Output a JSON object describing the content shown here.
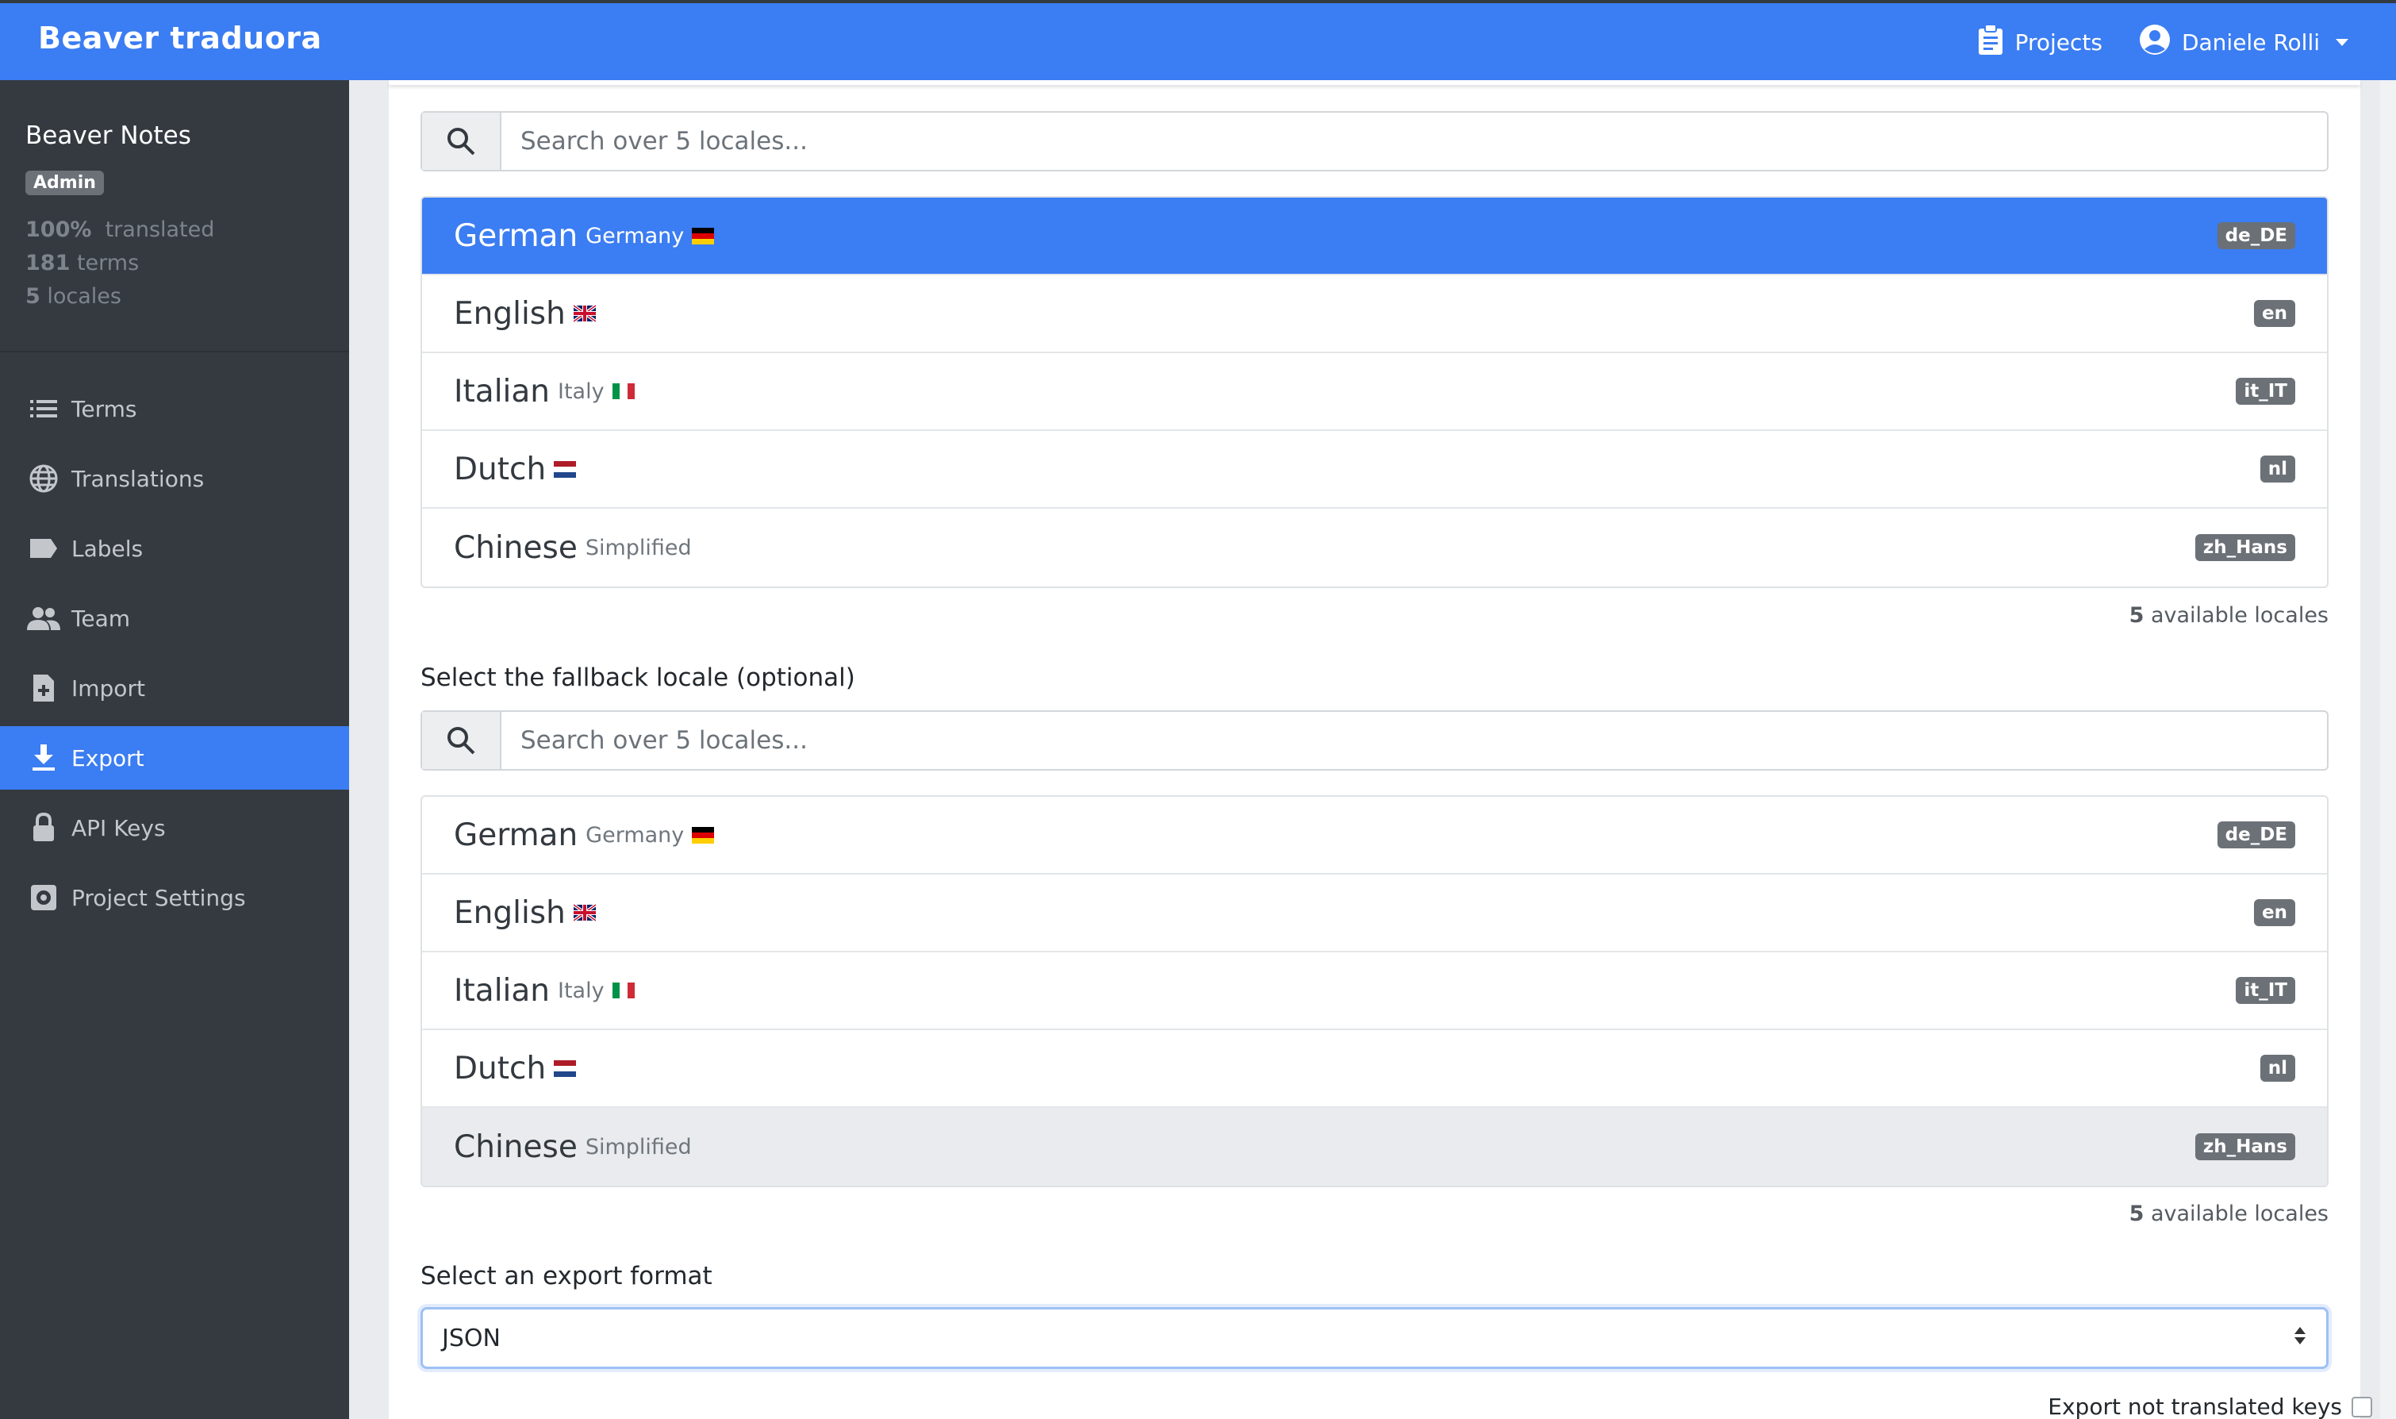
{
  "app": {
    "brand": "Beaver traduora",
    "projects_label": "Projects",
    "user_name": "Daniele Rolli"
  },
  "sidebar": {
    "project_name": "Beaver Notes",
    "role_badge": "Admin",
    "stats": {
      "translated_value": "100%",
      "translated_label": "translated",
      "terms_value": "181",
      "terms_label": "terms",
      "locales_value": "5",
      "locales_label": "locales"
    },
    "items": [
      {
        "label": "Terms",
        "icon": "list-icon"
      },
      {
        "label": "Translations",
        "icon": "globe-icon"
      },
      {
        "label": "Labels",
        "icon": "tag-icon"
      },
      {
        "label": "Team",
        "icon": "people-icon"
      },
      {
        "label": "Import",
        "icon": "file-plus-icon"
      },
      {
        "label": "Export",
        "icon": "download-icon",
        "active": true
      },
      {
        "label": "API Keys",
        "icon": "lock-icon"
      },
      {
        "label": "Project Settings",
        "icon": "cog-icon"
      }
    ]
  },
  "locale_search": {
    "placeholder": "Search over 5 locales..."
  },
  "locales_primary": [
    {
      "language": "German",
      "region": "Germany",
      "flag": "de-flag",
      "code": "de_DE",
      "state": "selected"
    },
    {
      "language": "English",
      "region": "",
      "flag": "gb-flag",
      "code": "en",
      "state": ""
    },
    {
      "language": "Italian",
      "region": "Italy",
      "flag": "it-flag",
      "code": "it_IT",
      "state": ""
    },
    {
      "language": "Dutch",
      "region": "",
      "flag": "nl-flag",
      "code": "nl",
      "state": ""
    },
    {
      "language": "Chinese",
      "region": "Simplified",
      "flag": "",
      "code": "zh_Hans",
      "state": ""
    }
  ],
  "available_primary": {
    "count": "5",
    "label": "available locales"
  },
  "fallback": {
    "label": "Select the fallback locale (optional)",
    "placeholder": "Search over 5 locales...",
    "locales": [
      {
        "language": "German",
        "region": "Germany",
        "flag": "de-flag",
        "code": "de_DE",
        "state": ""
      },
      {
        "language": "English",
        "region": "",
        "flag": "gb-flag",
        "code": "en",
        "state": ""
      },
      {
        "language": "Italian",
        "region": "Italy",
        "flag": "it-flag",
        "code": "it_IT",
        "state": ""
      },
      {
        "language": "Dutch",
        "region": "",
        "flag": "nl-flag",
        "code": "nl",
        "state": ""
      },
      {
        "language": "Chinese",
        "region": "Simplified",
        "flag": "",
        "code": "zh_Hans",
        "state": "hover"
      }
    ],
    "available": {
      "count": "5",
      "label": "available locales"
    }
  },
  "export_format": {
    "label": "Select an export format",
    "selected": "JSON"
  },
  "export_untranslated": {
    "label": "Export not translated keys",
    "checked": false
  },
  "colors": {
    "primary": "#3b7df2",
    "sidebar_bg": "#343a40",
    "badge_bg": "#6b7177"
  }
}
